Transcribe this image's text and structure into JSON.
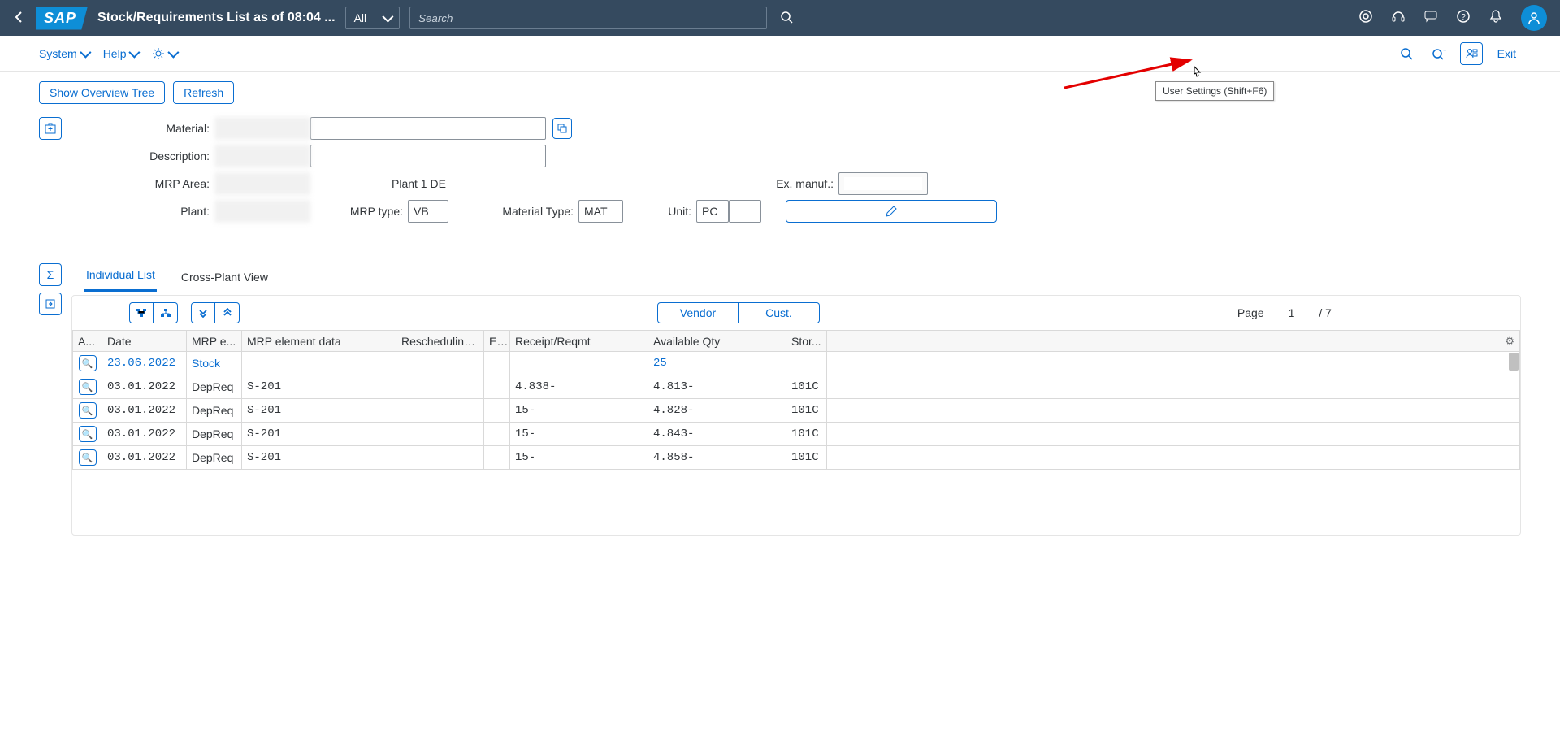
{
  "shell": {
    "title": "Stock/Requirements List as of 08:04 ...",
    "allLabel": "All",
    "searchPlaceholder": "Search"
  },
  "menu": {
    "system": "System",
    "help": "Help",
    "exit": "Exit"
  },
  "toolbar": {
    "overviewTree": "Show Overview Tree",
    "refresh": "Refresh"
  },
  "form": {
    "material_label": "Material:",
    "description_label": "Description:",
    "mrpArea_label": "MRP Area:",
    "plant_label": "Plant:",
    "plantName": "Plant 1 DE",
    "mrpType_label": "MRP type:",
    "mrpType_value": "VB",
    "materialType_label": "Material Type:",
    "materialType_value": "MAT",
    "unit_label": "Unit:",
    "unit_value": "PC",
    "exManuf_label": "Ex. manuf.:"
  },
  "tabs": {
    "individual": "Individual List",
    "crossPlant": "Cross-Plant View"
  },
  "mid": {
    "vendor": "Vendor",
    "cust": "Cust.",
    "page_label": "Page",
    "page_cur": "1",
    "page_sep": "/ 7"
  },
  "table": {
    "headers": {
      "a": "A...",
      "date": "Date",
      "mrpe": "MRP e...",
      "mrped": "MRP element data",
      "resch": "Rescheduling...",
      "e": "E...",
      "recr": "Receipt/Reqmt",
      "avail": "Available Qty",
      "stor": "Stor..."
    },
    "rows": [
      {
        "date": "23.06.2022",
        "mrpe": "Stock",
        "mrped": "",
        "recr": "",
        "avail": "25",
        "stor": "",
        "link": true
      },
      {
        "date": "03.01.2022",
        "mrpe": "DepReq",
        "mrped": "S-201",
        "recr": "4.838-",
        "avail": "4.813-",
        "stor": "101C",
        "link": false
      },
      {
        "date": "03.01.2022",
        "mrpe": "DepReq",
        "mrped": "S-201",
        "recr": "15-",
        "avail": "4.828-",
        "stor": "101C",
        "link": false
      },
      {
        "date": "03.01.2022",
        "mrpe": "DepReq",
        "mrped": "S-201",
        "recr": "15-",
        "avail": "4.843-",
        "stor": "101C",
        "link": false
      },
      {
        "date": "03.01.2022",
        "mrpe": "DepReq",
        "mrped": "S-201",
        "recr": "15-",
        "avail": "4.858-",
        "stor": "101C",
        "link": false
      }
    ]
  },
  "tooltip": {
    "text": "User Settings (Shift+F6)"
  }
}
